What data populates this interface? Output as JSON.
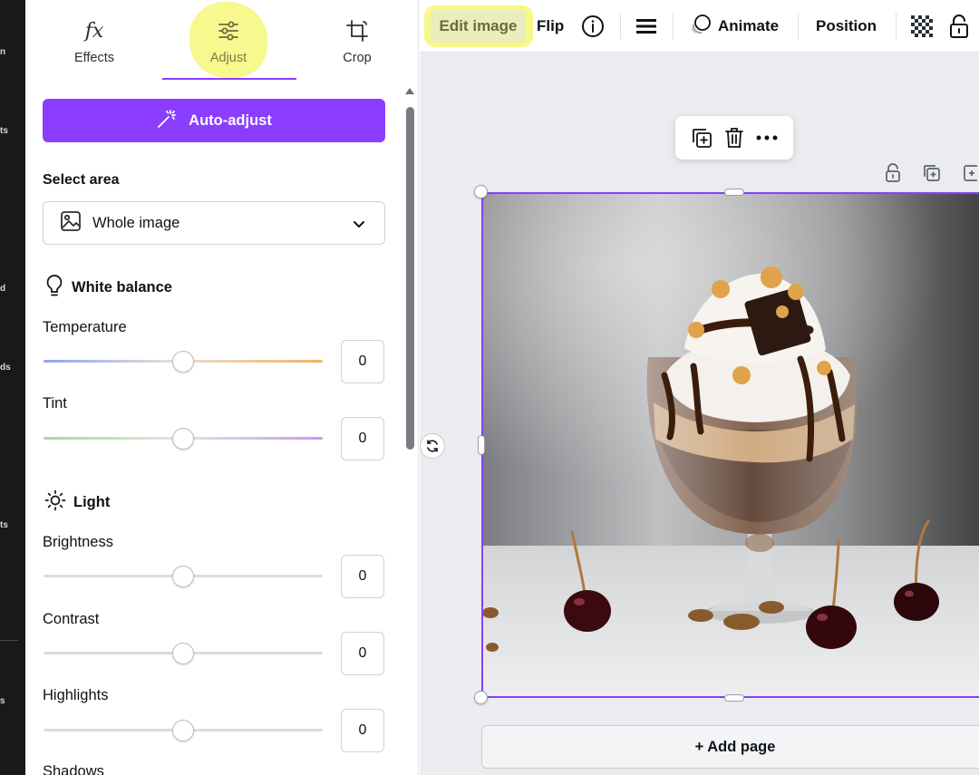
{
  "rail": {
    "fragments": [
      "n",
      "ts",
      "d",
      "ds",
      "ts",
      "s"
    ]
  },
  "panel": {
    "tabs": [
      {
        "label": "Effects",
        "icon": "fx-icon"
      },
      {
        "label": "Adjust",
        "icon": "sliders-icon",
        "active": true
      },
      {
        "label": "Crop",
        "icon": "crop-icon"
      }
    ],
    "auto_adjust_label": "Auto-adjust",
    "select_area": {
      "label": "Select area",
      "value": "Whole image"
    },
    "white_balance": {
      "heading": "White balance",
      "temperature": {
        "label": "Temperature",
        "value": "0",
        "level": 0.5
      },
      "tint": {
        "label": "Tint",
        "value": "0",
        "level": 0.5
      }
    },
    "light": {
      "heading": "Light",
      "brightness": {
        "label": "Brightness",
        "value": "0",
        "level": 0.5
      },
      "contrast": {
        "label": "Contrast",
        "value": "0",
        "level": 0.5
      },
      "highlights": {
        "label": "Highlights",
        "value": "0",
        "level": 0.5
      },
      "shadows": {
        "label": "Shadows"
      }
    }
  },
  "toolbar": {
    "edit_image": "Edit image",
    "flip": "Flip",
    "animate": "Animate",
    "position": "Position"
  },
  "canvas": {
    "add_page": "+ Add page"
  },
  "colors": {
    "accent": "#8b3dff",
    "highlight": "#f6f77a"
  }
}
